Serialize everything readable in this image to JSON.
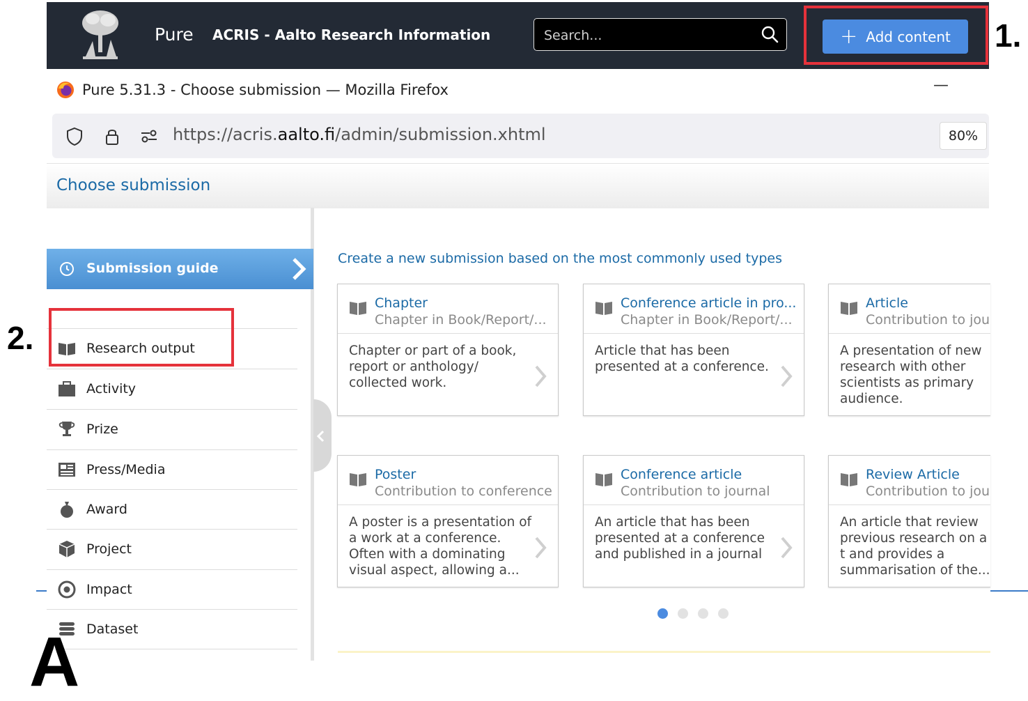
{
  "pure_header": {
    "brand": "Pure",
    "organization": "ACRIS - Aalto Research Information",
    "search_placeholder": "Search...",
    "add_content_label": "Add content"
  },
  "annotations": {
    "step1": "1.",
    "step2": "2.",
    "bottom_letter": "A"
  },
  "browser": {
    "window_title": "Pure 5.31.3 - Choose submission — Mozilla Firefox",
    "minimize_glyph": "—",
    "url_prefix": "https://acris.",
    "url_domain": "aalto.fi",
    "url_path": "/admin/submission.xhtml",
    "zoom": "80%"
  },
  "page": {
    "title": "Choose submission",
    "intro": "Create a new submission based on the most commonly used types"
  },
  "sidebar": {
    "guide_label": "Submission guide",
    "items": [
      {
        "label": "Research output",
        "icon": "book-icon"
      },
      {
        "label": "Activity",
        "icon": "briefcase-icon"
      },
      {
        "label": "Prize",
        "icon": "trophy-icon"
      },
      {
        "label": "Press/Media",
        "icon": "newspaper-icon"
      },
      {
        "label": "Award",
        "icon": "money-bag-icon"
      },
      {
        "label": "Project",
        "icon": "cube-icon"
      },
      {
        "label": "Impact",
        "icon": "target-icon"
      },
      {
        "label": "Dataset",
        "icon": "database-icon"
      }
    ]
  },
  "cards": [
    {
      "title": "Chapter",
      "subtitle": "Chapter in Book/Report/...",
      "description": "Chapter or part of a book, report or anthology/ collected work."
    },
    {
      "title": "Conference article in pro...",
      "subtitle": "Chapter in Book/Report/...",
      "description": "Article that has been presented at a conference."
    },
    {
      "title": "Article",
      "subtitle": "Contribution to jour",
      "description": "A presentation of new research with other scientists as primary audience."
    },
    {
      "title": "Poster",
      "subtitle": "Contribution to conference",
      "description": "A poster is a presentation of a work at a conference. Often with a dominating visual aspect, allowing a..."
    },
    {
      "title": "Conference article",
      "subtitle": "Contribution to journal",
      "description": "An article that has been presented at a conference and published in a journal"
    },
    {
      "title": "Review Article",
      "subtitle": "Contribution to jour",
      "description": "An article that review previous research on a t and provides a summarisation of the..."
    }
  ],
  "pagination": {
    "pages": 4,
    "active_index": 0
  },
  "colors": {
    "header_bg": "#232a35",
    "accent_blue": "#4b8be0",
    "link_blue": "#1b6aa6",
    "highlight_red": "#e5323b"
  }
}
